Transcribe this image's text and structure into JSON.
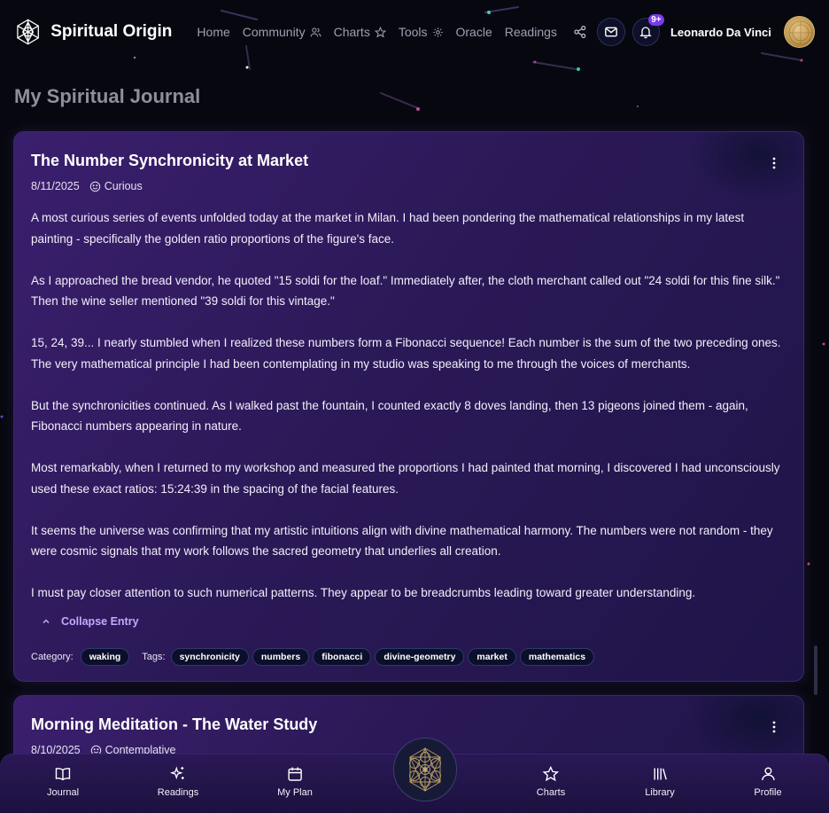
{
  "colors": {
    "background": "#07080f",
    "card_gradient_start": "#3b1f6e",
    "card_gradient_end": "#1f1448",
    "accent_purple": "#7c3aed",
    "collapse_link": "#c4a9ff",
    "nav_link": "#9ba0b3"
  },
  "header": {
    "brand": "Spiritual Origin",
    "logo_icon": "sacred-geometry-logo-icon",
    "nav": [
      {
        "label": "Home",
        "icon": ""
      },
      {
        "label": "Community",
        "icon": "users-icon"
      },
      {
        "label": "Charts",
        "icon": "star-icon"
      },
      {
        "label": "Tools",
        "icon": "gear-icon"
      },
      {
        "label": "Oracle",
        "icon": ""
      },
      {
        "label": "Readings",
        "icon": ""
      }
    ],
    "share_icon": "share-icon",
    "mail_icon": "mail-icon",
    "bell_icon": "bell-icon",
    "notification_badge": "9+",
    "user_name": "Leonardo Da Vinci"
  },
  "page": {
    "title": "My Spiritual Journal"
  },
  "entries": [
    {
      "title": "The Number Synchronicity at Market",
      "date": "8/11/2025",
      "mood": "Curious",
      "mood_icon": "smile-icon",
      "paragraphs": [
        "A most curious series of events unfolded today at the market in Milan. I had been pondering the mathematical relationships in my latest painting - specifically the golden ratio proportions of the figure's face.",
        "As I approached the bread vendor, he quoted \"15 soldi for the loaf.\" Immediately after, the cloth merchant called out \"24 soldi for this fine silk.\" Then the wine seller mentioned \"39 soldi for this vintage.\"",
        "15, 24, 39... I nearly stumbled when I realized these numbers form a Fibonacci sequence! Each number is the sum of the two preceding ones. The very mathematical principle I had been contemplating in my studio was speaking to me through the voices of merchants.",
        "But the synchronicities continued. As I walked past the fountain, I counted exactly 8 doves landing, then 13 pigeons joined them - again, Fibonacci numbers appearing in nature.",
        "Most remarkably, when I returned to my workshop and measured the proportions I had painted that morning, I discovered I had unconsciously used these exact ratios: 15:24:39 in the spacing of the facial features.",
        "It seems the universe was confirming that my artistic intuitions align with divine mathematical harmony. The numbers were not random - they were cosmic signals that my work follows the sacred geometry that underlies all creation.",
        "I must pay closer attention to such numerical patterns. They appear to be breadcrumbs leading toward greater understanding."
      ],
      "collapse_label": "Collapse Entry",
      "category_label": "Category:",
      "category": "waking",
      "tags_label": "Tags:",
      "tags": [
        "synchronicity",
        "numbers",
        "fibonacci",
        "divine-geometry",
        "market",
        "mathematics"
      ]
    },
    {
      "title": "Morning Meditation - The Water Study",
      "date": "8/10/2025",
      "mood": "Contemplative",
      "mood_icon": "smile-icon"
    }
  ],
  "bottom_nav": {
    "items": [
      {
        "label": "Journal",
        "icon": "book-open-icon"
      },
      {
        "label": "Readings",
        "icon": "sparkles-icon"
      },
      {
        "label": "My Plan",
        "icon": "calendar-icon"
      },
      {
        "label": "Charts",
        "icon": "star-icon"
      },
      {
        "label": "Library",
        "icon": "library-icon"
      },
      {
        "label": "Profile",
        "icon": "user-icon"
      }
    ],
    "center_icon": "metatron-cube-icon"
  }
}
